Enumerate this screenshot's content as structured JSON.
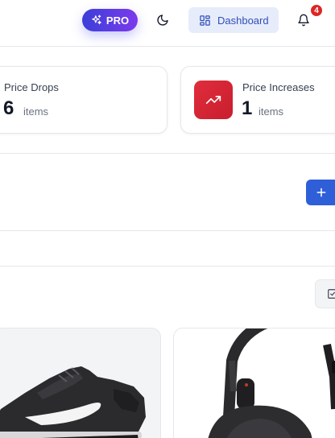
{
  "header": {
    "pro_label": "PRO",
    "dashboard_label": "Dashboard",
    "notification_count": "4"
  },
  "stats": [
    {
      "title": "Price Drops",
      "count": "6",
      "unit": "items",
      "icon": "trending-down-icon"
    },
    {
      "title": "Price Increases",
      "count": "1",
      "unit": "items",
      "icon": "trending-up-icon"
    }
  ],
  "colors": {
    "accent": "#2f5fd8",
    "pro_gradient_start": "#3b3fd8",
    "pro_gradient_end": "#7c3aed",
    "increase_red": "#dc2b3a",
    "badge_red": "#dc2626"
  },
  "products": [
    {
      "image": "sneaker-image"
    },
    {
      "image": "headphones-image"
    }
  ]
}
